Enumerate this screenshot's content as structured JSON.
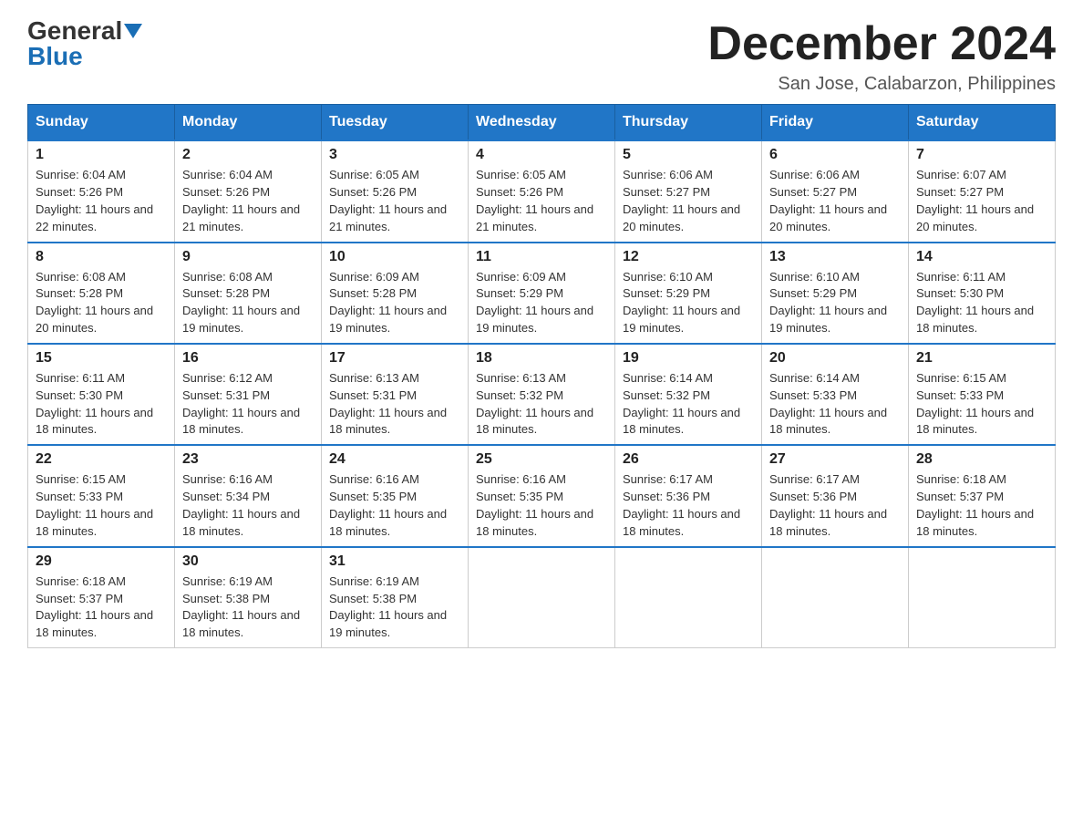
{
  "header": {
    "logo": {
      "general": "General",
      "blue": "Blue"
    },
    "title": "December 2024",
    "location": "San Jose, Calabarzon, Philippines"
  },
  "days_of_week": [
    "Sunday",
    "Monday",
    "Tuesday",
    "Wednesday",
    "Thursday",
    "Friday",
    "Saturday"
  ],
  "weeks": [
    [
      {
        "day": "1",
        "sunrise": "6:04 AM",
        "sunset": "5:26 PM",
        "daylight": "11 hours and 22 minutes."
      },
      {
        "day": "2",
        "sunrise": "6:04 AM",
        "sunset": "5:26 PM",
        "daylight": "11 hours and 21 minutes."
      },
      {
        "day": "3",
        "sunrise": "6:05 AM",
        "sunset": "5:26 PM",
        "daylight": "11 hours and 21 minutes."
      },
      {
        "day": "4",
        "sunrise": "6:05 AM",
        "sunset": "5:26 PM",
        "daylight": "11 hours and 21 minutes."
      },
      {
        "day": "5",
        "sunrise": "6:06 AM",
        "sunset": "5:27 PM",
        "daylight": "11 hours and 20 minutes."
      },
      {
        "day": "6",
        "sunrise": "6:06 AM",
        "sunset": "5:27 PM",
        "daylight": "11 hours and 20 minutes."
      },
      {
        "day": "7",
        "sunrise": "6:07 AM",
        "sunset": "5:27 PM",
        "daylight": "11 hours and 20 minutes."
      }
    ],
    [
      {
        "day": "8",
        "sunrise": "6:08 AM",
        "sunset": "5:28 PM",
        "daylight": "11 hours and 20 minutes."
      },
      {
        "day": "9",
        "sunrise": "6:08 AM",
        "sunset": "5:28 PM",
        "daylight": "11 hours and 19 minutes."
      },
      {
        "day": "10",
        "sunrise": "6:09 AM",
        "sunset": "5:28 PM",
        "daylight": "11 hours and 19 minutes."
      },
      {
        "day": "11",
        "sunrise": "6:09 AM",
        "sunset": "5:29 PM",
        "daylight": "11 hours and 19 minutes."
      },
      {
        "day": "12",
        "sunrise": "6:10 AM",
        "sunset": "5:29 PM",
        "daylight": "11 hours and 19 minutes."
      },
      {
        "day": "13",
        "sunrise": "6:10 AM",
        "sunset": "5:29 PM",
        "daylight": "11 hours and 19 minutes."
      },
      {
        "day": "14",
        "sunrise": "6:11 AM",
        "sunset": "5:30 PM",
        "daylight": "11 hours and 18 minutes."
      }
    ],
    [
      {
        "day": "15",
        "sunrise": "6:11 AM",
        "sunset": "5:30 PM",
        "daylight": "11 hours and 18 minutes."
      },
      {
        "day": "16",
        "sunrise": "6:12 AM",
        "sunset": "5:31 PM",
        "daylight": "11 hours and 18 minutes."
      },
      {
        "day": "17",
        "sunrise": "6:13 AM",
        "sunset": "5:31 PM",
        "daylight": "11 hours and 18 minutes."
      },
      {
        "day": "18",
        "sunrise": "6:13 AM",
        "sunset": "5:32 PM",
        "daylight": "11 hours and 18 minutes."
      },
      {
        "day": "19",
        "sunrise": "6:14 AM",
        "sunset": "5:32 PM",
        "daylight": "11 hours and 18 minutes."
      },
      {
        "day": "20",
        "sunrise": "6:14 AM",
        "sunset": "5:33 PM",
        "daylight": "11 hours and 18 minutes."
      },
      {
        "day": "21",
        "sunrise": "6:15 AM",
        "sunset": "5:33 PM",
        "daylight": "11 hours and 18 minutes."
      }
    ],
    [
      {
        "day": "22",
        "sunrise": "6:15 AM",
        "sunset": "5:33 PM",
        "daylight": "11 hours and 18 minutes."
      },
      {
        "day": "23",
        "sunrise": "6:16 AM",
        "sunset": "5:34 PM",
        "daylight": "11 hours and 18 minutes."
      },
      {
        "day": "24",
        "sunrise": "6:16 AM",
        "sunset": "5:35 PM",
        "daylight": "11 hours and 18 minutes."
      },
      {
        "day": "25",
        "sunrise": "6:16 AM",
        "sunset": "5:35 PM",
        "daylight": "11 hours and 18 minutes."
      },
      {
        "day": "26",
        "sunrise": "6:17 AM",
        "sunset": "5:36 PM",
        "daylight": "11 hours and 18 minutes."
      },
      {
        "day": "27",
        "sunrise": "6:17 AM",
        "sunset": "5:36 PM",
        "daylight": "11 hours and 18 minutes."
      },
      {
        "day": "28",
        "sunrise": "6:18 AM",
        "sunset": "5:37 PM",
        "daylight": "11 hours and 18 minutes."
      }
    ],
    [
      {
        "day": "29",
        "sunrise": "6:18 AM",
        "sunset": "5:37 PM",
        "daylight": "11 hours and 18 minutes."
      },
      {
        "day": "30",
        "sunrise": "6:19 AM",
        "sunset": "5:38 PM",
        "daylight": "11 hours and 18 minutes."
      },
      {
        "day": "31",
        "sunrise": "6:19 AM",
        "sunset": "5:38 PM",
        "daylight": "11 hours and 19 minutes."
      },
      null,
      null,
      null,
      null
    ]
  ]
}
